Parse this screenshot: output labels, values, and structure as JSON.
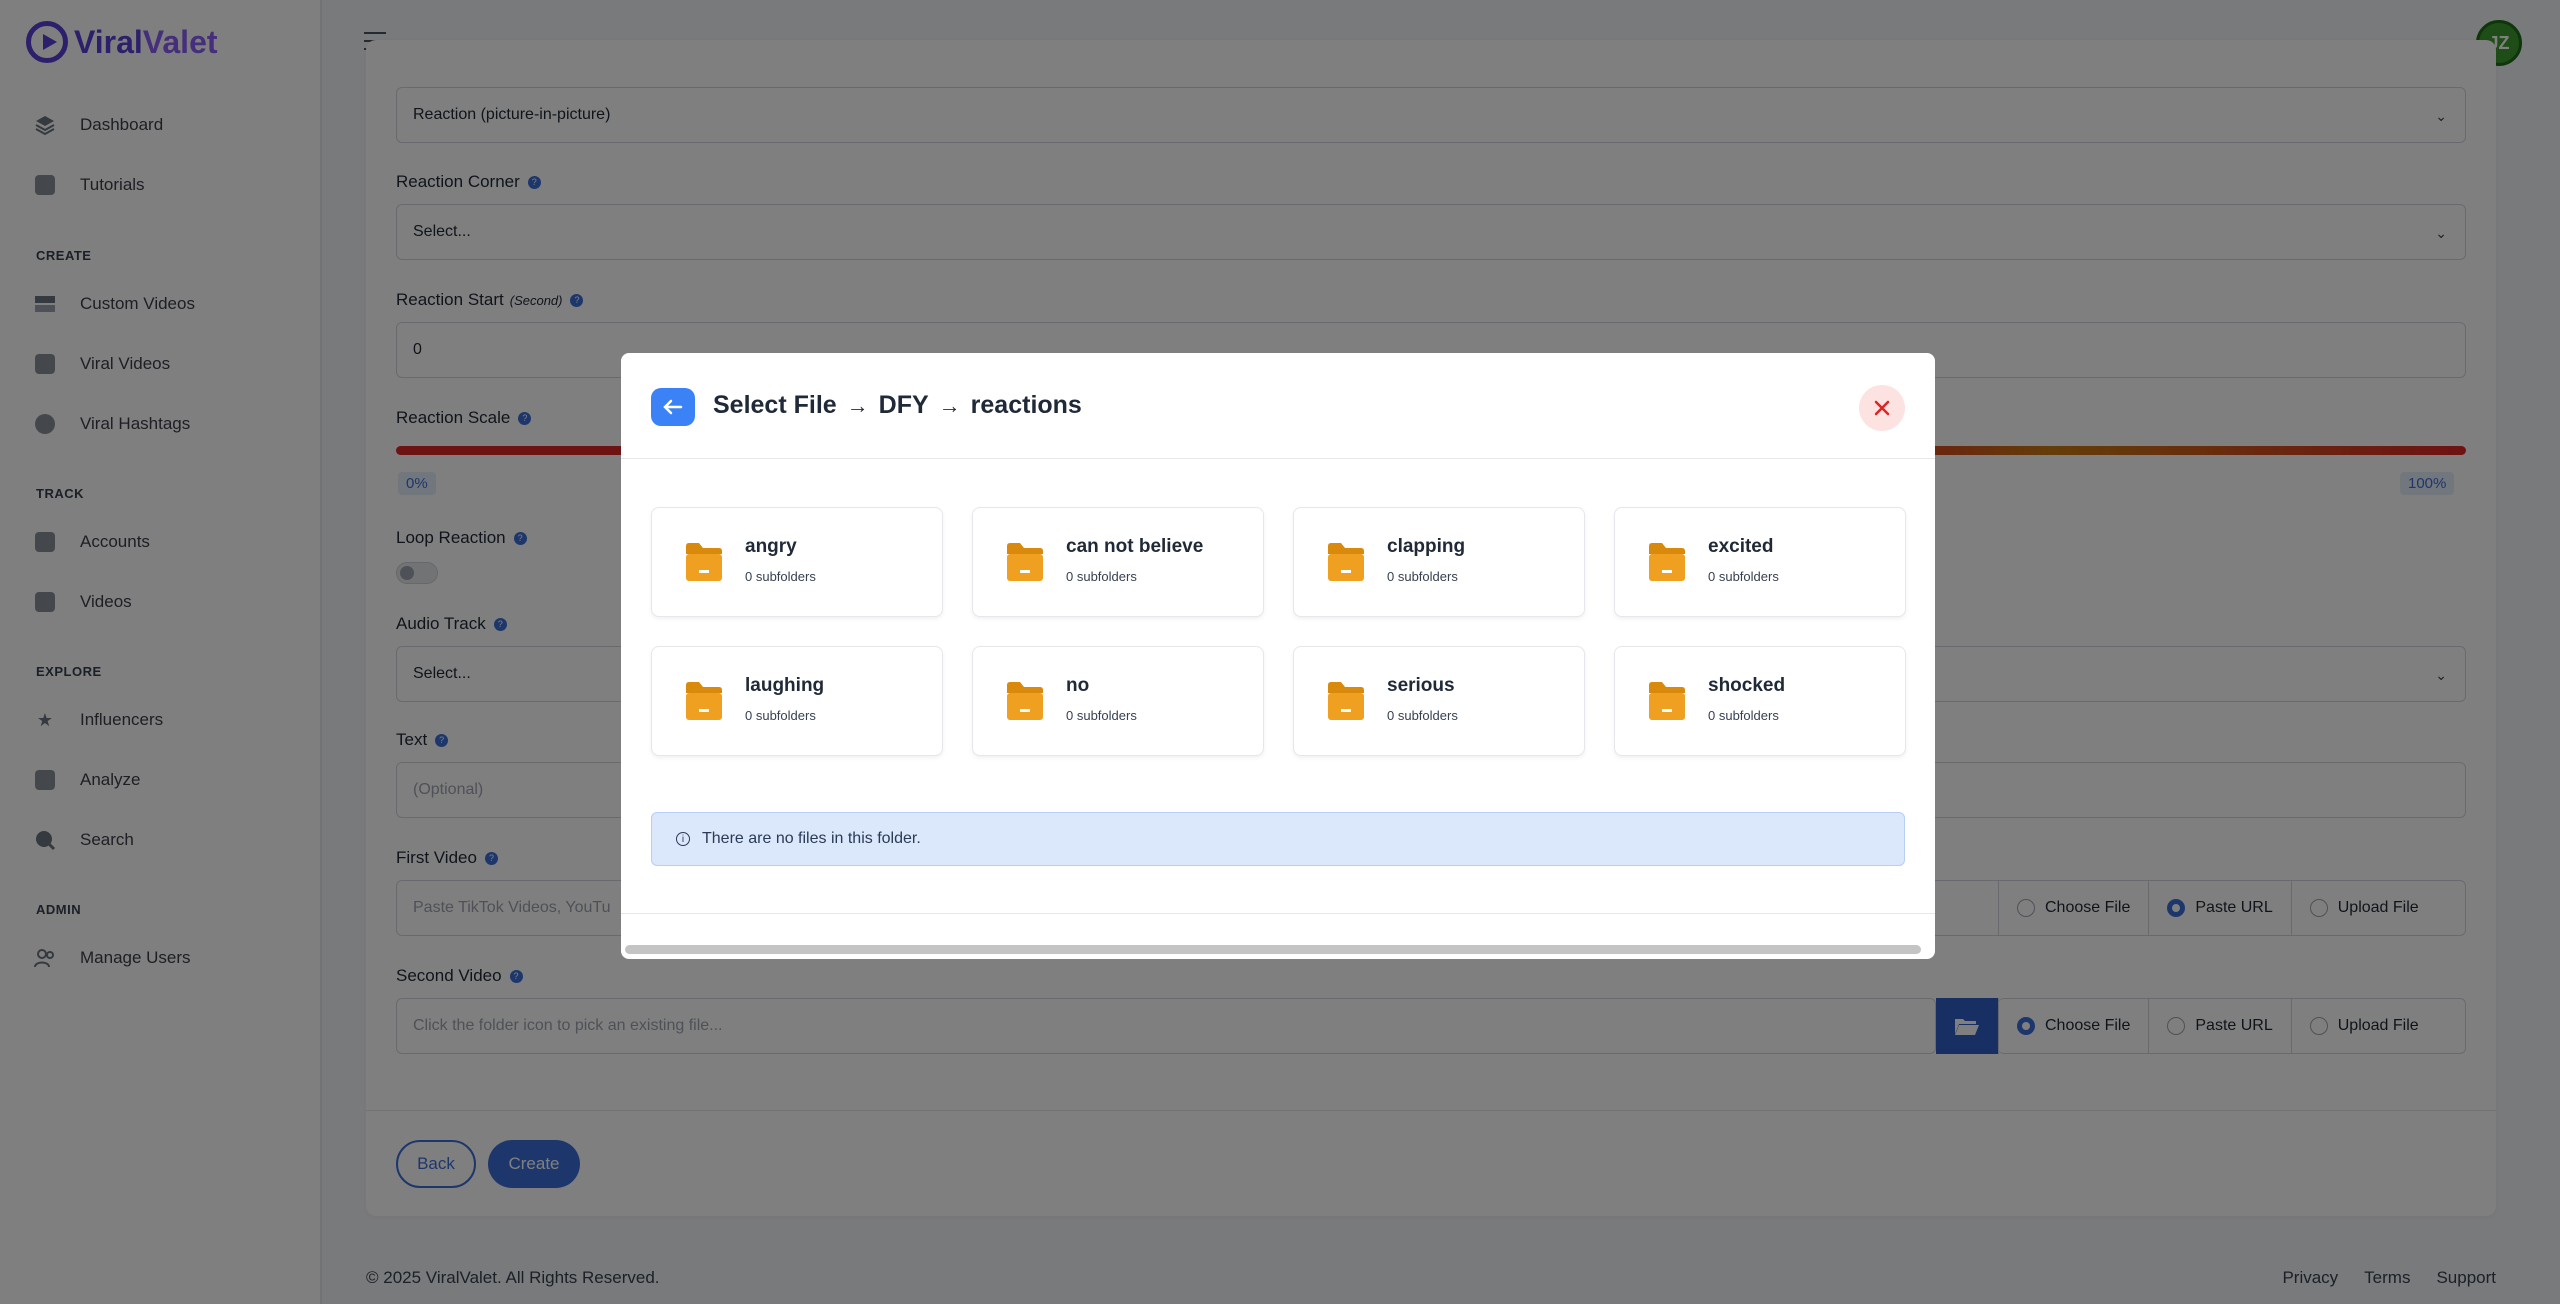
{
  "brand": {
    "name_part1": "Viral",
    "name_part2": "Valet"
  },
  "sidebar": {
    "items_top": [
      {
        "label": "Dashboard",
        "icon": "layers-icon"
      },
      {
        "label": "Tutorials",
        "icon": "tutorial-icon"
      }
    ],
    "sections": [
      {
        "title": "CREATE",
        "items": [
          {
            "label": "Custom Videos",
            "icon": "video-icon"
          },
          {
            "label": "Viral Videos",
            "icon": "chart-icon"
          },
          {
            "label": "Viral Hashtags",
            "icon": "hashtag-icon"
          }
        ]
      },
      {
        "title": "TRACK",
        "items": [
          {
            "label": "Accounts",
            "icon": "account-icon"
          },
          {
            "label": "Videos",
            "icon": "videos-icon"
          }
        ]
      },
      {
        "title": "EXPLORE",
        "items": [
          {
            "label": "Influencers",
            "icon": "star-icon"
          },
          {
            "label": "Analyze",
            "icon": "presentation-icon"
          },
          {
            "label": "Search",
            "icon": "search-icon"
          }
        ]
      },
      {
        "title": "ADMIN",
        "items": [
          {
            "label": "Manage Users",
            "icon": "users-icon"
          }
        ]
      }
    ]
  },
  "header": {
    "avatar_initials": "JZ"
  },
  "form": {
    "layout_value": "Reaction (picture-in-picture)",
    "reaction_corner_label": "Reaction Corner",
    "reaction_corner_value": "Select...",
    "reaction_start_label": "Reaction Start",
    "reaction_start_unit": "(Second)",
    "reaction_start_value": "0",
    "reaction_scale_label": "Reaction Scale",
    "scale_min": "0%",
    "scale_max": "100%",
    "loop_reaction_label": "Loop Reaction",
    "audio_track_label": "Audio Track",
    "audio_track_value": "Select...",
    "text_label": "Text",
    "text_placeholder": "(Optional)",
    "first_video_label": "First Video",
    "first_video_placeholder": "Paste TikTok Videos, YouTu",
    "second_video_label": "Second Video",
    "second_video_placeholder": "Click the folder icon to pick an existing file...",
    "source_options": [
      "Choose File",
      "Paste URL",
      "Upload File"
    ],
    "back_label": "Back",
    "create_label": "Create"
  },
  "footer": {
    "copyright": "© 2025 ViralValet. All Rights Reserved.",
    "links": [
      "Privacy",
      "Terms",
      "Support"
    ]
  },
  "modal": {
    "title_root": "Select File",
    "path": [
      "DFY",
      "reactions"
    ],
    "folders": [
      {
        "name": "angry",
        "sub": "0 subfolders"
      },
      {
        "name": "can not believe",
        "sub": "0 subfolders"
      },
      {
        "name": "clapping",
        "sub": "0 subfolders"
      },
      {
        "name": "excited",
        "sub": "0 subfolders"
      },
      {
        "name": "laughing",
        "sub": "0 subfolders"
      },
      {
        "name": "no",
        "sub": "0 subfolders"
      },
      {
        "name": "serious",
        "sub": "0 subfolders"
      },
      {
        "name": "shocked",
        "sub": "0 subfolders"
      }
    ],
    "empty_message": "There are no files in this folder."
  }
}
